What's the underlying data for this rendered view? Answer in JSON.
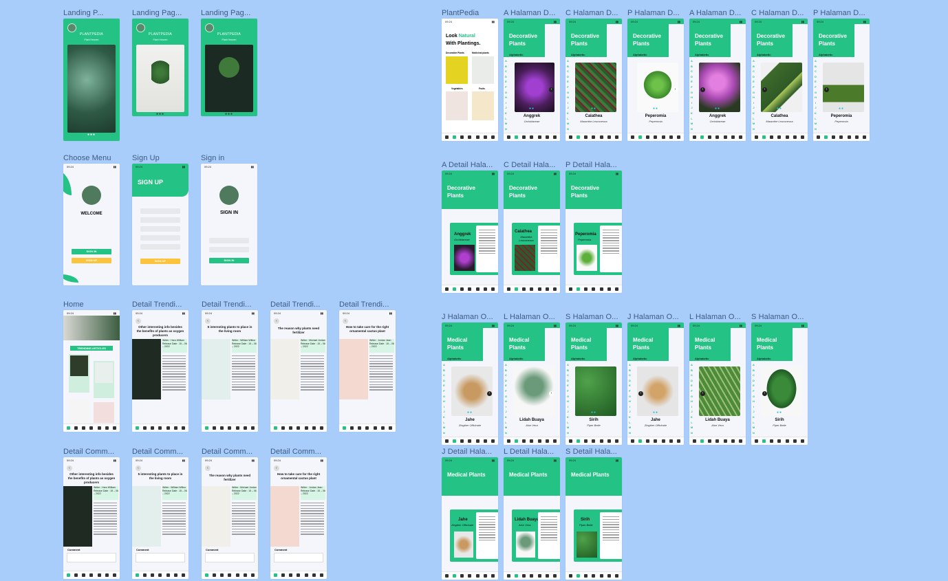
{
  "colors": {
    "canvas": "#a9cdfb",
    "brand_green": "#25c285",
    "accent_yellow": "#fcc33d",
    "dot_cyan": "#22c1e0"
  },
  "frames": {
    "landing1": "Landing P...",
    "landing2": "Landing Pag...",
    "landing3": "Landing Pag...",
    "choose": "Choose Menu",
    "signup": "Sign Up",
    "signin": "Sign in",
    "home": "Home",
    "trend1": "Detail Trendi...",
    "trend2": "Detail Trendi...",
    "trend3": "Detail Trendi...",
    "trend4": "Detail Trendi...",
    "comm1": "Detail Comm...",
    "comm2": "Detail Comm...",
    "comm3": "Detail Comm...",
    "comm4": "Detail Comm...",
    "plantpedia": "PlantPedia",
    "a_hal_d1": "A Halaman D...",
    "c_hal_d1": "C Halaman D...",
    "p_hal_d1": "P Halaman D...",
    "a_hal_d2": "A Halaman D...",
    "c_hal_d2": "C Halaman D...",
    "p_hal_d2": "P Halaman D...",
    "a_detail": "A Detail Hala...",
    "c_detail": "C Detail Hala...",
    "p_detail": "P Detail Hala...",
    "j_hal_o1": "J Halaman O...",
    "l_hal_o1": "L Halaman O...",
    "s_hal_o1": "S Halaman O...",
    "j_hal_o2": "J Halaman O...",
    "l_hal_o2": "L Halaman O...",
    "s_hal_o2": "S Halaman O...",
    "j_detail": "J Detail Hala...",
    "l_detail": "L Detail Hala...",
    "s_detail": "S Detail Hala..."
  },
  "landing": {
    "title": "PLANTPEDIA",
    "subtitle": "Plant Heaven"
  },
  "auth": {
    "welcome": "WELCOME",
    "sign_up_title": "SIGN UP",
    "sign_in_title": "SIGN IN",
    "btn_sign_in": "SIGN IN",
    "btn_sign_up": "SIGN UP"
  },
  "home": {
    "trending": "TRENDING ARTICLES"
  },
  "articles": [
    {
      "title": "Other interesting info besides the benefits of plants as oxygen producers",
      "meta": "Writer : Haru William Release Date : 15 – 06 – 2022"
    },
    {
      "title": "5 interesting plants to place in the living room",
      "meta": "Writer : William Wilbur Release Date : 15 – 06 – 2022"
    },
    {
      "title": "The reason why plants need fertilizer",
      "meta": "Writer : Michael Jordan Release Date : 15 – 06 – 2022"
    },
    {
      "title": "How to take care for the right ornamental cactus plant",
      "meta": "Writer : Jordan Jean Release Date : 15 – 06 – 2022"
    }
  ],
  "comment_label": "Comment",
  "plantpedia": {
    "look": "Look",
    "natural": "Natural",
    "with_plantings": "With Plantings.",
    "cat1": "Decorative Plants",
    "cat2": "Medicinal plants",
    "cat3": "Vegetables",
    "cat4": "Fruits"
  },
  "decorative_header": "Decorative Plants",
  "medical_header": "Medical Plants",
  "alphabetic": "Alphabetic",
  "alphabet": "A B C D E F G H I J K L M N",
  "decorative_plants": [
    {
      "name": "Anggrek",
      "latin": "Orchidaceae"
    },
    {
      "name": "Calathea",
      "latin": "Maranthe Leuconeura"
    },
    {
      "name": "Peperomia",
      "latin": "Peperomia"
    }
  ],
  "medical_plants": [
    {
      "name": "Jahe",
      "latin": "Zingiber Officinale"
    },
    {
      "name": "Lidah Buaya",
      "latin": "Aloe Vera"
    },
    {
      "name": "Sirih",
      "latin": "Piper Betle"
    }
  ]
}
